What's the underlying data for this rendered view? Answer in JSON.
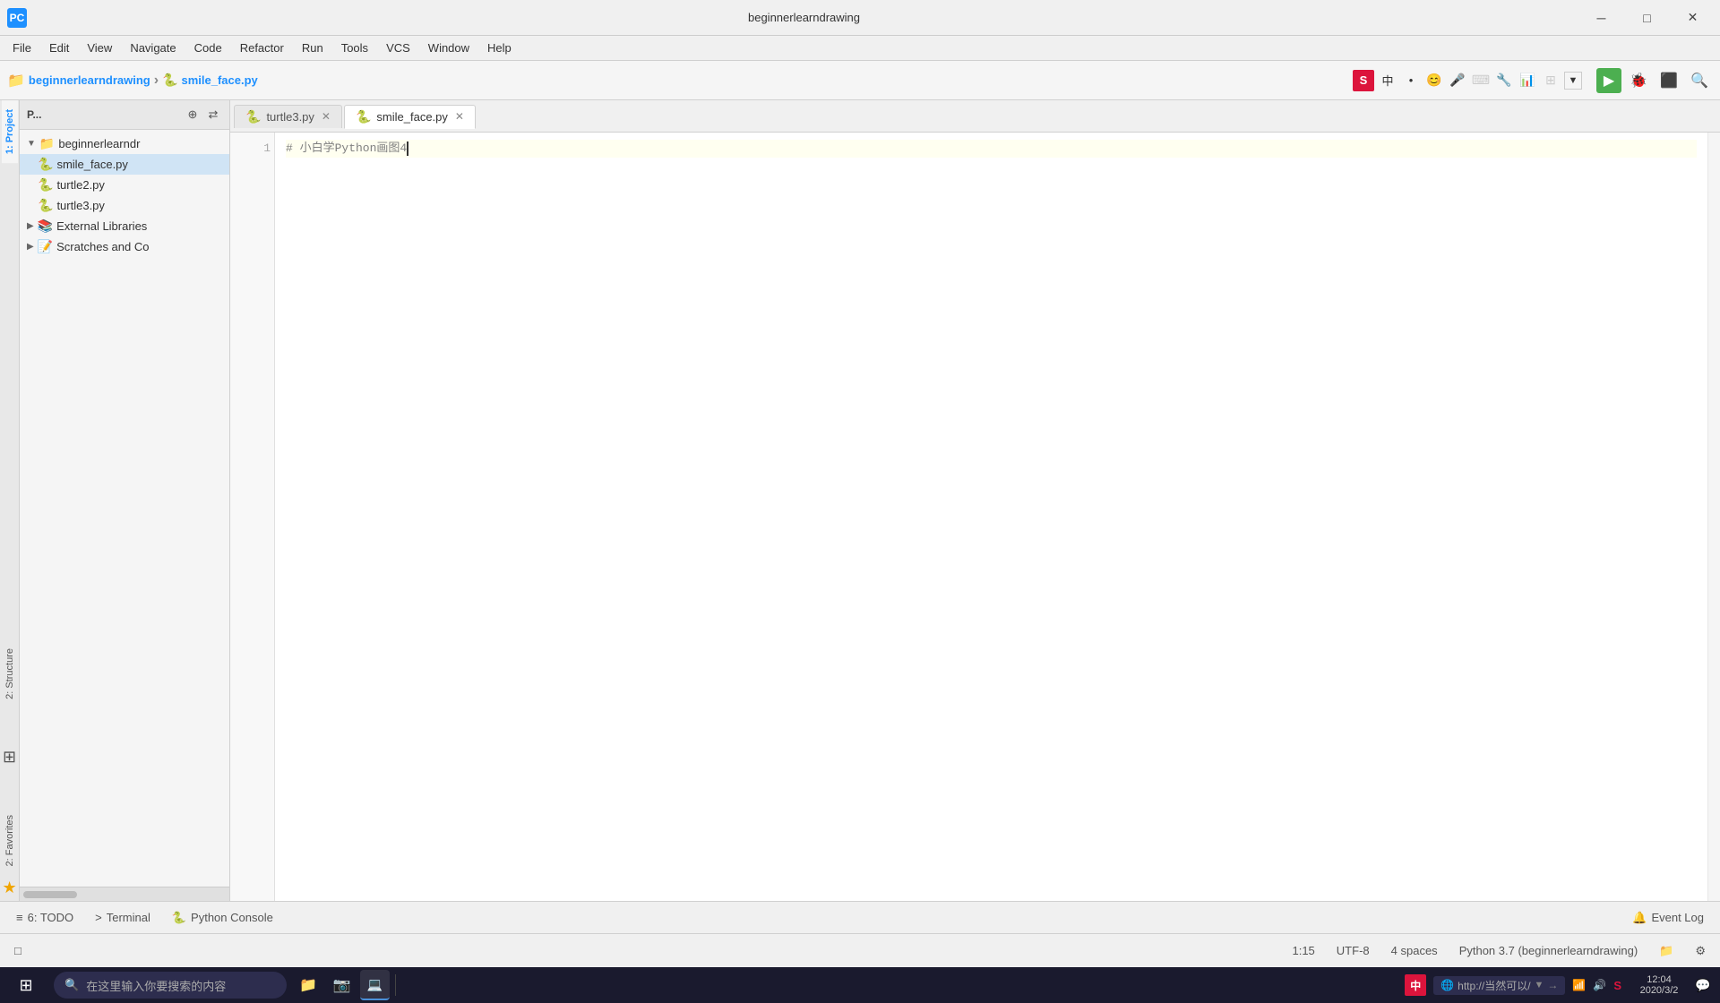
{
  "window": {
    "title": "beginnerlearndrawing",
    "icon": "PC"
  },
  "menu": {
    "items": [
      "File",
      "Edit",
      "View",
      "Navigate",
      "Code",
      "Refactor",
      "Run",
      "Tools",
      "VCS",
      "Window",
      "Help"
    ]
  },
  "toolbar": {
    "breadcrumb_project": "beginnerlearndrawing",
    "breadcrumb_file": "smile_face.py",
    "separator": "›"
  },
  "project_panel": {
    "title": "P...",
    "root": "beginnerlearndr",
    "files": [
      {
        "name": "smile_face.py",
        "type": "python",
        "selected": true
      },
      {
        "name": "turtle2.py",
        "type": "python"
      },
      {
        "name": "turtle3.py",
        "type": "python"
      }
    ],
    "extra_items": [
      "External Libraries",
      "Scratches and Co"
    ]
  },
  "editor": {
    "tabs": [
      {
        "label": "turtle3.py",
        "active": false,
        "closeable": true
      },
      {
        "label": "smile_face.py",
        "active": true,
        "closeable": true
      }
    ],
    "lines": [
      {
        "num": 1,
        "content": "#  小白学Python画图4",
        "type": "comment",
        "highlighted": true
      }
    ],
    "cursor": "1:15"
  },
  "side_tabs": {
    "top": [
      "1: Project"
    ],
    "middle": [
      "2: Structure"
    ],
    "bottom": [
      "2: Favorites"
    ]
  },
  "bottom_panel": {
    "tabs": [
      {
        "label": "6: TODO",
        "icon": "≡"
      },
      {
        "label": "Terminal",
        "icon": ">"
      },
      {
        "label": "Python Console",
        "icon": "🐍"
      }
    ],
    "right_tab": {
      "label": "Event Log",
      "icon": "🔔"
    }
  },
  "status_bar": {
    "cursor_pos": "1:15",
    "encoding": "UTF-8",
    "indent": "4 spaces",
    "interpreter": "Python 3.7 (beginnerlearndrawing)",
    "venv_icon": "📁",
    "settings_icon": "⚙"
  },
  "taskbar": {
    "search_placeholder": "在这里输入你要搜索的内容",
    "ime_label": "中",
    "apps": [
      {
        "name": "file-explorer",
        "icon": "📁"
      },
      {
        "name": "camera-app",
        "icon": "📷"
      },
      {
        "name": "pycharm",
        "icon": "PC"
      }
    ],
    "systray": {
      "url": "http://当然可以/",
      "time": "12:04",
      "date": "2020/3/2"
    }
  }
}
